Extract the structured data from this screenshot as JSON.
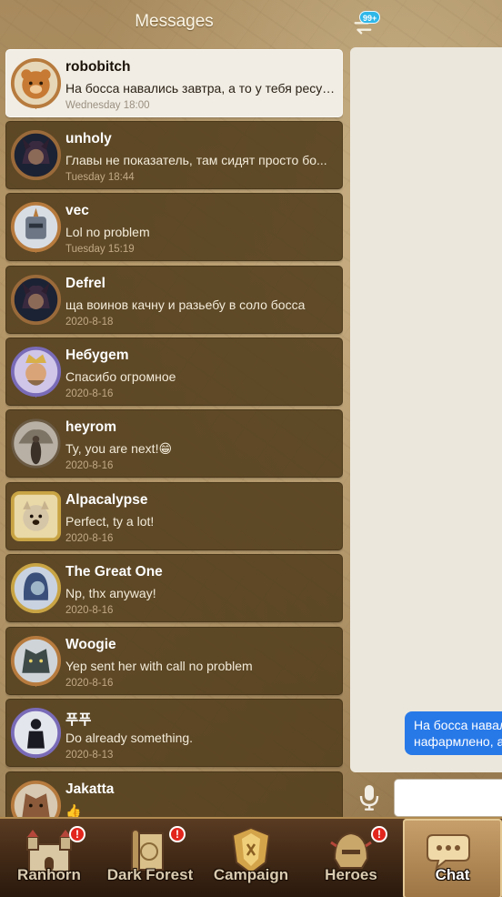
{
  "header": {
    "title": "Messages",
    "swap_icon": "swap-arrows-icon",
    "badge": "99+"
  },
  "conversations": [
    {
      "name": "robobitch",
      "message": "На босса навались завтра, а то у тебя ресурсов маловато",
      "time": "Wednesday 18:00",
      "avatar": "bear-avatar"
    },
    {
      "name": "unholy",
      "message": "Главы не показатель, там сидят просто бо...",
      "time": "Tuesday 18:44",
      "avatar": "dark-hero-avatar"
    },
    {
      "name": "vec",
      "message": "Lol no problem",
      "time": "Tuesday 15:19",
      "avatar": "knight-avatar"
    },
    {
      "name": "Defrel",
      "message": "ща воинов качну и разьебу в соло босса",
      "time": "2020-8-18",
      "avatar": "dark-hero-avatar"
    },
    {
      "name": "Небуgem",
      "message": "Спасибо огромное",
      "time": "2020-8-16",
      "avatar": "king-avatar"
    },
    {
      "name": "heyrom",
      "message": "Ty, you are next!😁",
      "time": "2020-8-16",
      "avatar": "photo-avatar"
    },
    {
      "name": "Alpacalypse",
      "message": "Perfect, ty a lot!",
      "time": "2020-8-16",
      "avatar": "dog-avatar"
    },
    {
      "name": "The Great One",
      "message": "Np, thx anyway!",
      "time": "2020-8-16",
      "avatar": "ghost-avatar"
    },
    {
      "name": "Woogie",
      "message": "Yep sent her with call no problem",
      "time": "2020-8-16",
      "avatar": "beast-avatar"
    },
    {
      "name": "푸푸",
      "message": "Do already something.",
      "time": "2020-8-13",
      "avatar": "suit-avatar"
    },
    {
      "name": "Jakatta",
      "message": "👍",
      "time": "",
      "avatar": "beast-avatar"
    }
  ],
  "chat": {
    "bubble_lines": [
      "На босса навал",
      "нафармлено, а"
    ],
    "input_value": "",
    "input_placeholder": ""
  },
  "nav": [
    {
      "label": "Ranhorn",
      "icon": "castle-icon",
      "alert": "!"
    },
    {
      "label": "Dark Forest",
      "icon": "map-scroll-icon",
      "alert": "!"
    },
    {
      "label": "Campaign",
      "icon": "crest-icon",
      "alert": ""
    },
    {
      "label": "Heroes",
      "icon": "helmet-icon",
      "alert": "!"
    },
    {
      "label": "Chat",
      "icon": "chat-bubble-icon",
      "alert": ""
    }
  ],
  "colors": {
    "accent_blue": "#2879e8",
    "badge_blue": "#2fb7e8",
    "alert_red": "#e2261d",
    "card_brown": "#523e1c"
  }
}
